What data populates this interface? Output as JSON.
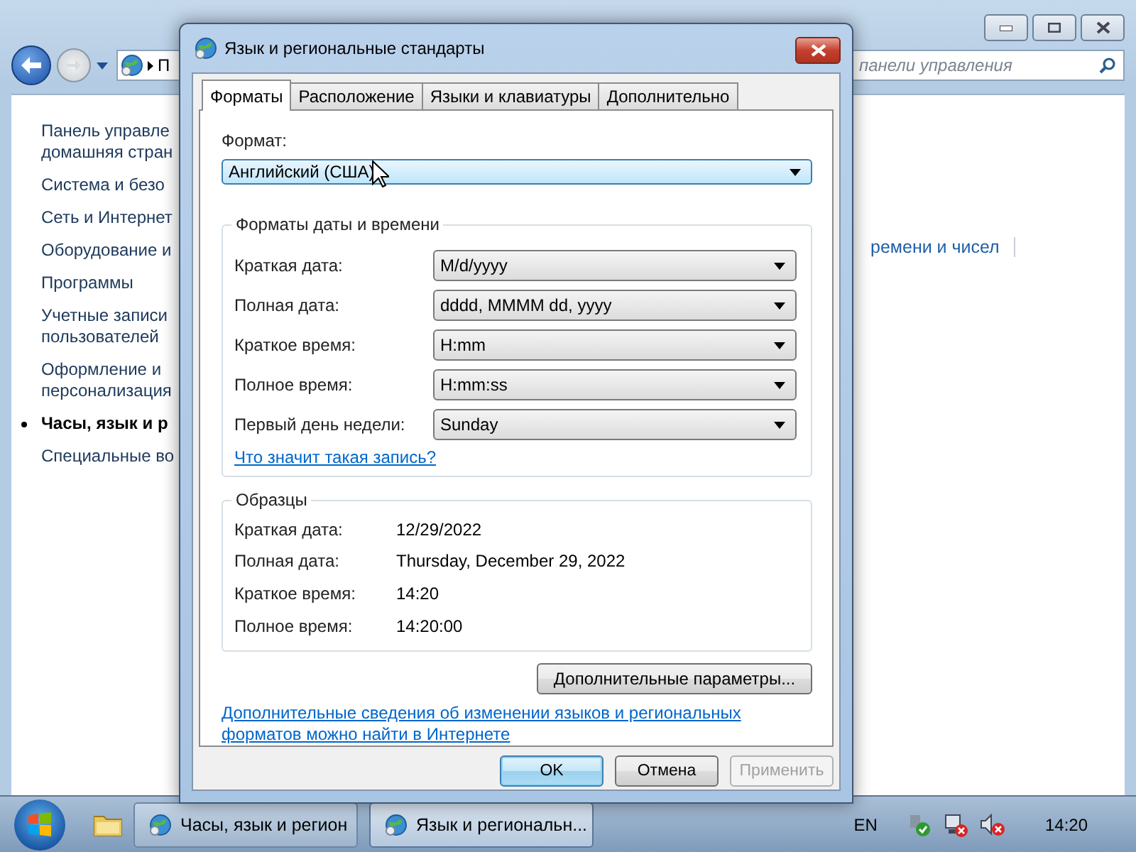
{
  "explorer": {
    "address_text": "П",
    "search": {
      "placeholder": "панели управления"
    },
    "sidebar": {
      "items": [
        {
          "lines": [
            "Панель управле",
            "домашняя стран"
          ],
          "selected": false
        },
        {
          "lines": [
            "Система и безо"
          ],
          "selected": false
        },
        {
          "lines": [
            "Сеть и Интернет"
          ],
          "selected": false
        },
        {
          "lines": [
            "Оборудование и"
          ],
          "selected": false
        },
        {
          "lines": [
            "Программы"
          ],
          "selected": false
        },
        {
          "lines": [
            "Учетные записи",
            "пользователей"
          ],
          "selected": false
        },
        {
          "lines": [
            "Оформление и",
            "персонализация"
          ],
          "selected": false
        },
        {
          "lines": [
            "Часы, язык и р"
          ],
          "selected": true
        },
        {
          "lines": [
            "Специальные во"
          ],
          "selected": false
        }
      ]
    },
    "content_text": "ремени и чисел"
  },
  "dialog": {
    "title": "Язык и региональные стандарты",
    "tabs": [
      {
        "label": "Форматы",
        "selected": true
      },
      {
        "label": "Расположение",
        "selected": false
      },
      {
        "label": "Языки и клавиатуры",
        "selected": false
      },
      {
        "label": "Дополнительно",
        "selected": false
      }
    ],
    "format_label": "Формат:",
    "format_value": "Английский (США)",
    "group_title": "Форматы даты и времени",
    "formats": [
      {
        "label": "Краткая дата:",
        "value": "M/d/yyyy"
      },
      {
        "label": "Полная дата:",
        "value": "dddd, MMMM dd, yyyy"
      },
      {
        "label": "Краткое время:",
        "value": "H:mm"
      },
      {
        "label": "Полное время:",
        "value": "H:mm:ss"
      },
      {
        "label": "Первый день недели:",
        "value": "Sunday"
      }
    ],
    "help_link": "Что значит такая запись?",
    "samples_title": "Образцы",
    "samples": [
      {
        "label": "Краткая дата:",
        "value": "12/29/2022"
      },
      {
        "label": "Полная дата:",
        "value": "Thursday, December 29, 2022"
      },
      {
        "label": "Краткое время:",
        "value": "14:20"
      },
      {
        "label": "Полное время:",
        "value": "14:20:00"
      }
    ],
    "advanced_button": "Дополнительные параметры...",
    "info_link": "Дополнительные сведения об изменении языков и региональных форматов можно найти в Интернете",
    "buttons": [
      {
        "label": "OK",
        "default": true,
        "disabled": false
      },
      {
        "label": "Отмена",
        "default": false,
        "disabled": false
      },
      {
        "label": "Применить",
        "default": false,
        "disabled": true
      }
    ]
  },
  "taskbar": {
    "tasks": [
      {
        "label": "Часы, язык и регион",
        "selected": false
      },
      {
        "label": "Язык и региональн...",
        "selected": true
      }
    ],
    "language": "EN",
    "clock": "14:20"
  }
}
